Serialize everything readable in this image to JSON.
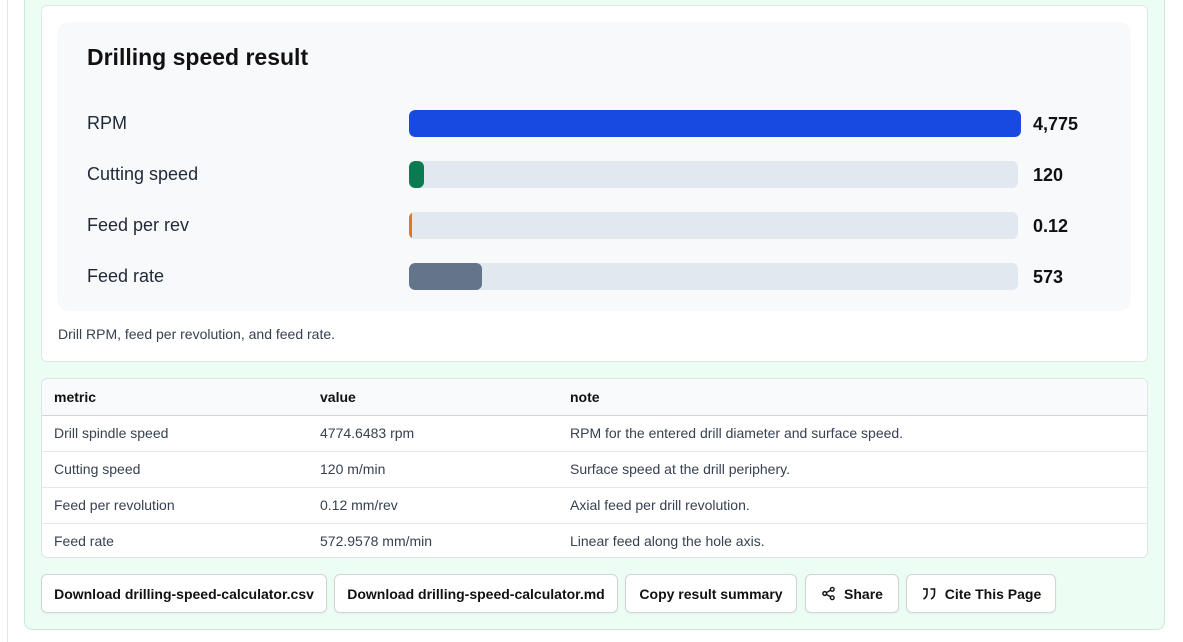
{
  "chart_card": {
    "title": "Drilling speed result",
    "caption": "Drill RPM, feed per revolution, and feed rate."
  },
  "chart_data": {
    "type": "bar",
    "orientation": "horizontal",
    "title": "Drilling speed result",
    "categories": [
      "RPM",
      "Cutting speed",
      "Feed per rev",
      "Feed rate"
    ],
    "values": [
      4775,
      120,
      0.12,
      573
    ],
    "value_labels": [
      "4,775",
      "120",
      "0.12",
      "573"
    ],
    "colors": [
      "#1849e0",
      "#0a7a50",
      "#e2771f",
      "#64748b"
    ],
    "xlim": [
      0,
      4775
    ],
    "grid": false,
    "legend": "none"
  },
  "table": {
    "headers": [
      "metric",
      "value",
      "note"
    ],
    "rows": [
      [
        "Drill spindle speed",
        "4774.6483 rpm",
        "RPM for the entered drill diameter and surface speed."
      ],
      [
        "Cutting speed",
        "120 m/min",
        "Surface speed at the drill periphery."
      ],
      [
        "Feed per revolution",
        "0.12 mm/rev",
        "Axial feed per drill revolution."
      ],
      [
        "Feed rate",
        "572.9578 mm/min",
        "Linear feed along the hole axis."
      ]
    ]
  },
  "actions": {
    "download_csv": "Download drilling-speed-calculator.csv",
    "download_md": "Download drilling-speed-calculator.md",
    "copy_summary": "Copy result summary",
    "share": "Share",
    "cite": "Cite This Page"
  },
  "icons": {
    "share": "share-icon",
    "cite": "quote-icon"
  }
}
